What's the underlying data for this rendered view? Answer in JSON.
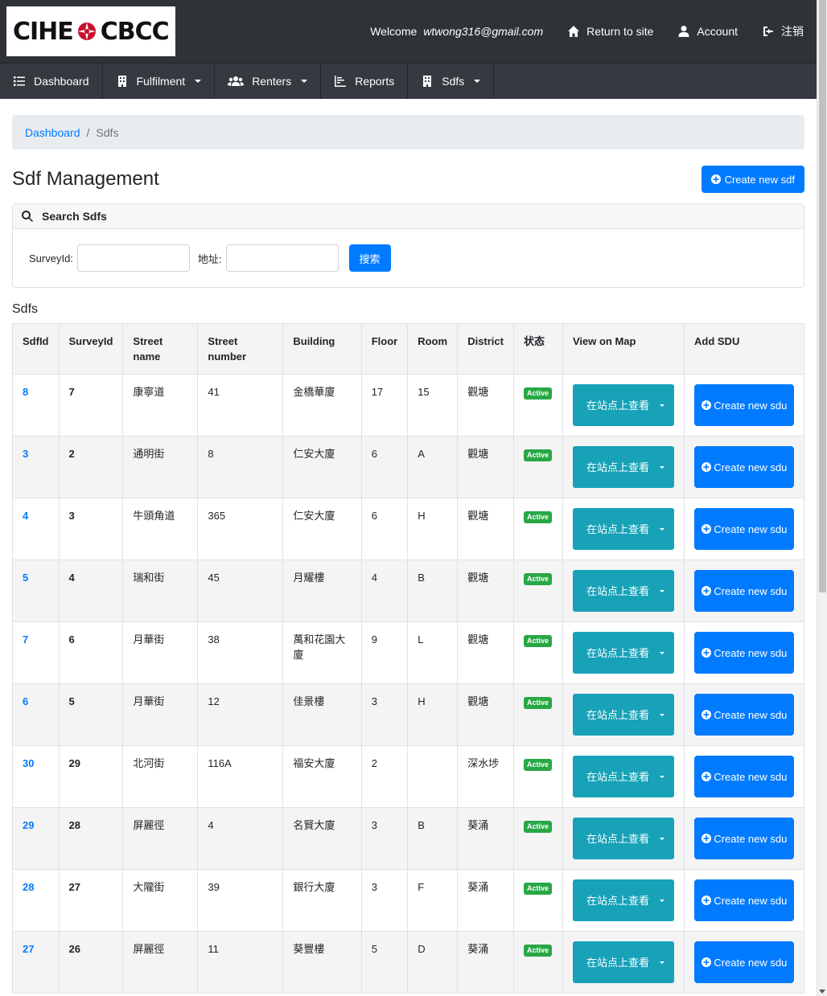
{
  "header": {
    "logo_left": "CIHE",
    "logo_right": "CBCC",
    "welcome_prefix": "Welcome",
    "welcome_user": "wtwong316@gmail.com",
    "return_to_site": "Return to site",
    "account": "Account",
    "logout": "注销"
  },
  "nav": {
    "items": [
      {
        "label": "Dashboard",
        "icon": "list-icon",
        "dropdown": false
      },
      {
        "label": "Fulfilment",
        "icon": "building-icon",
        "dropdown": true
      },
      {
        "label": "Renters",
        "icon": "users-icon",
        "dropdown": true
      },
      {
        "label": "Reports",
        "icon": "chart-icon",
        "dropdown": false
      },
      {
        "label": "Sdfs",
        "icon": "building-icon",
        "dropdown": true
      }
    ]
  },
  "breadcrumb": {
    "home": "Dashboard",
    "sep": "/",
    "current": "Sdfs"
  },
  "page": {
    "title": "Sdf Management",
    "create_button": "Create new sdf"
  },
  "search": {
    "header": "Search Sdfs",
    "survey_label": "SurveyId:",
    "survey_value": "",
    "address_label": "地址:",
    "address_value": "",
    "button": "搜索"
  },
  "table": {
    "title": "Sdfs",
    "columns": [
      "SdfId",
      "SurveyId",
      "Street name",
      "Street number",
      "Building",
      "Floor",
      "Room",
      "District",
      "状态",
      "View on Map",
      "Add SDU"
    ],
    "map_button": "在站点上查看",
    "sdu_button": "Create new sdu",
    "rows": [
      {
        "sdfid": "8",
        "surveyid": "7",
        "street": "康寧道",
        "number": "41",
        "building": "金橋華廈",
        "floor": "17",
        "room": "15",
        "district": "觀塘",
        "status": "Active"
      },
      {
        "sdfid": "3",
        "surveyid": "2",
        "street": "通明街",
        "number": "8",
        "building": "仁安大廈",
        "floor": "6",
        "room": "A",
        "district": "觀塘",
        "status": "Active"
      },
      {
        "sdfid": "4",
        "surveyid": "3",
        "street": "牛頭角道",
        "number": "365",
        "building": "仁安大廈",
        "floor": "6",
        "room": "H",
        "district": "觀塘",
        "status": "Active"
      },
      {
        "sdfid": "5",
        "surveyid": "4",
        "street": "瑞和街",
        "number": "45",
        "building": "月耀樓",
        "floor": "4",
        "room": "B",
        "district": "觀塘",
        "status": "Active"
      },
      {
        "sdfid": "7",
        "surveyid": "6",
        "street": "月華街",
        "number": "38",
        "building": "萬和花園大廈",
        "floor": "9",
        "room": "L",
        "district": "觀塘",
        "status": "Active"
      },
      {
        "sdfid": "6",
        "surveyid": "5",
        "street": "月華街",
        "number": "12",
        "building": "佳景樓",
        "floor": "3",
        "room": "H",
        "district": "觀塘",
        "status": "Active"
      },
      {
        "sdfid": "30",
        "surveyid": "29",
        "street": "北河街",
        "number": "116A",
        "building": "福安大廈",
        "floor": "2",
        "room": "",
        "district": "深水埗",
        "status": "Active"
      },
      {
        "sdfid": "29",
        "surveyid": "28",
        "street": "屏麗徑",
        "number": "4",
        "building": "名賢大廈",
        "floor": "3",
        "room": "B",
        "district": "葵涌",
        "status": "Active"
      },
      {
        "sdfid": "28",
        "surveyid": "27",
        "street": "大隴街",
        "number": "39",
        "building": "銀行大廈",
        "floor": "3",
        "room": "F",
        "district": "葵涌",
        "status": "Active"
      },
      {
        "sdfid": "27",
        "surveyid": "26",
        "street": "屏麗徑",
        "number": "11",
        "building": "葵豐樓",
        "floor": "5",
        "room": "D",
        "district": "葵涌",
        "status": "Active"
      }
    ]
  },
  "colors": {
    "header_bg": "#2f3337",
    "nav_bg": "#343a40",
    "primary": "#007bff",
    "info": "#17a2b8",
    "success": "#28a745"
  }
}
